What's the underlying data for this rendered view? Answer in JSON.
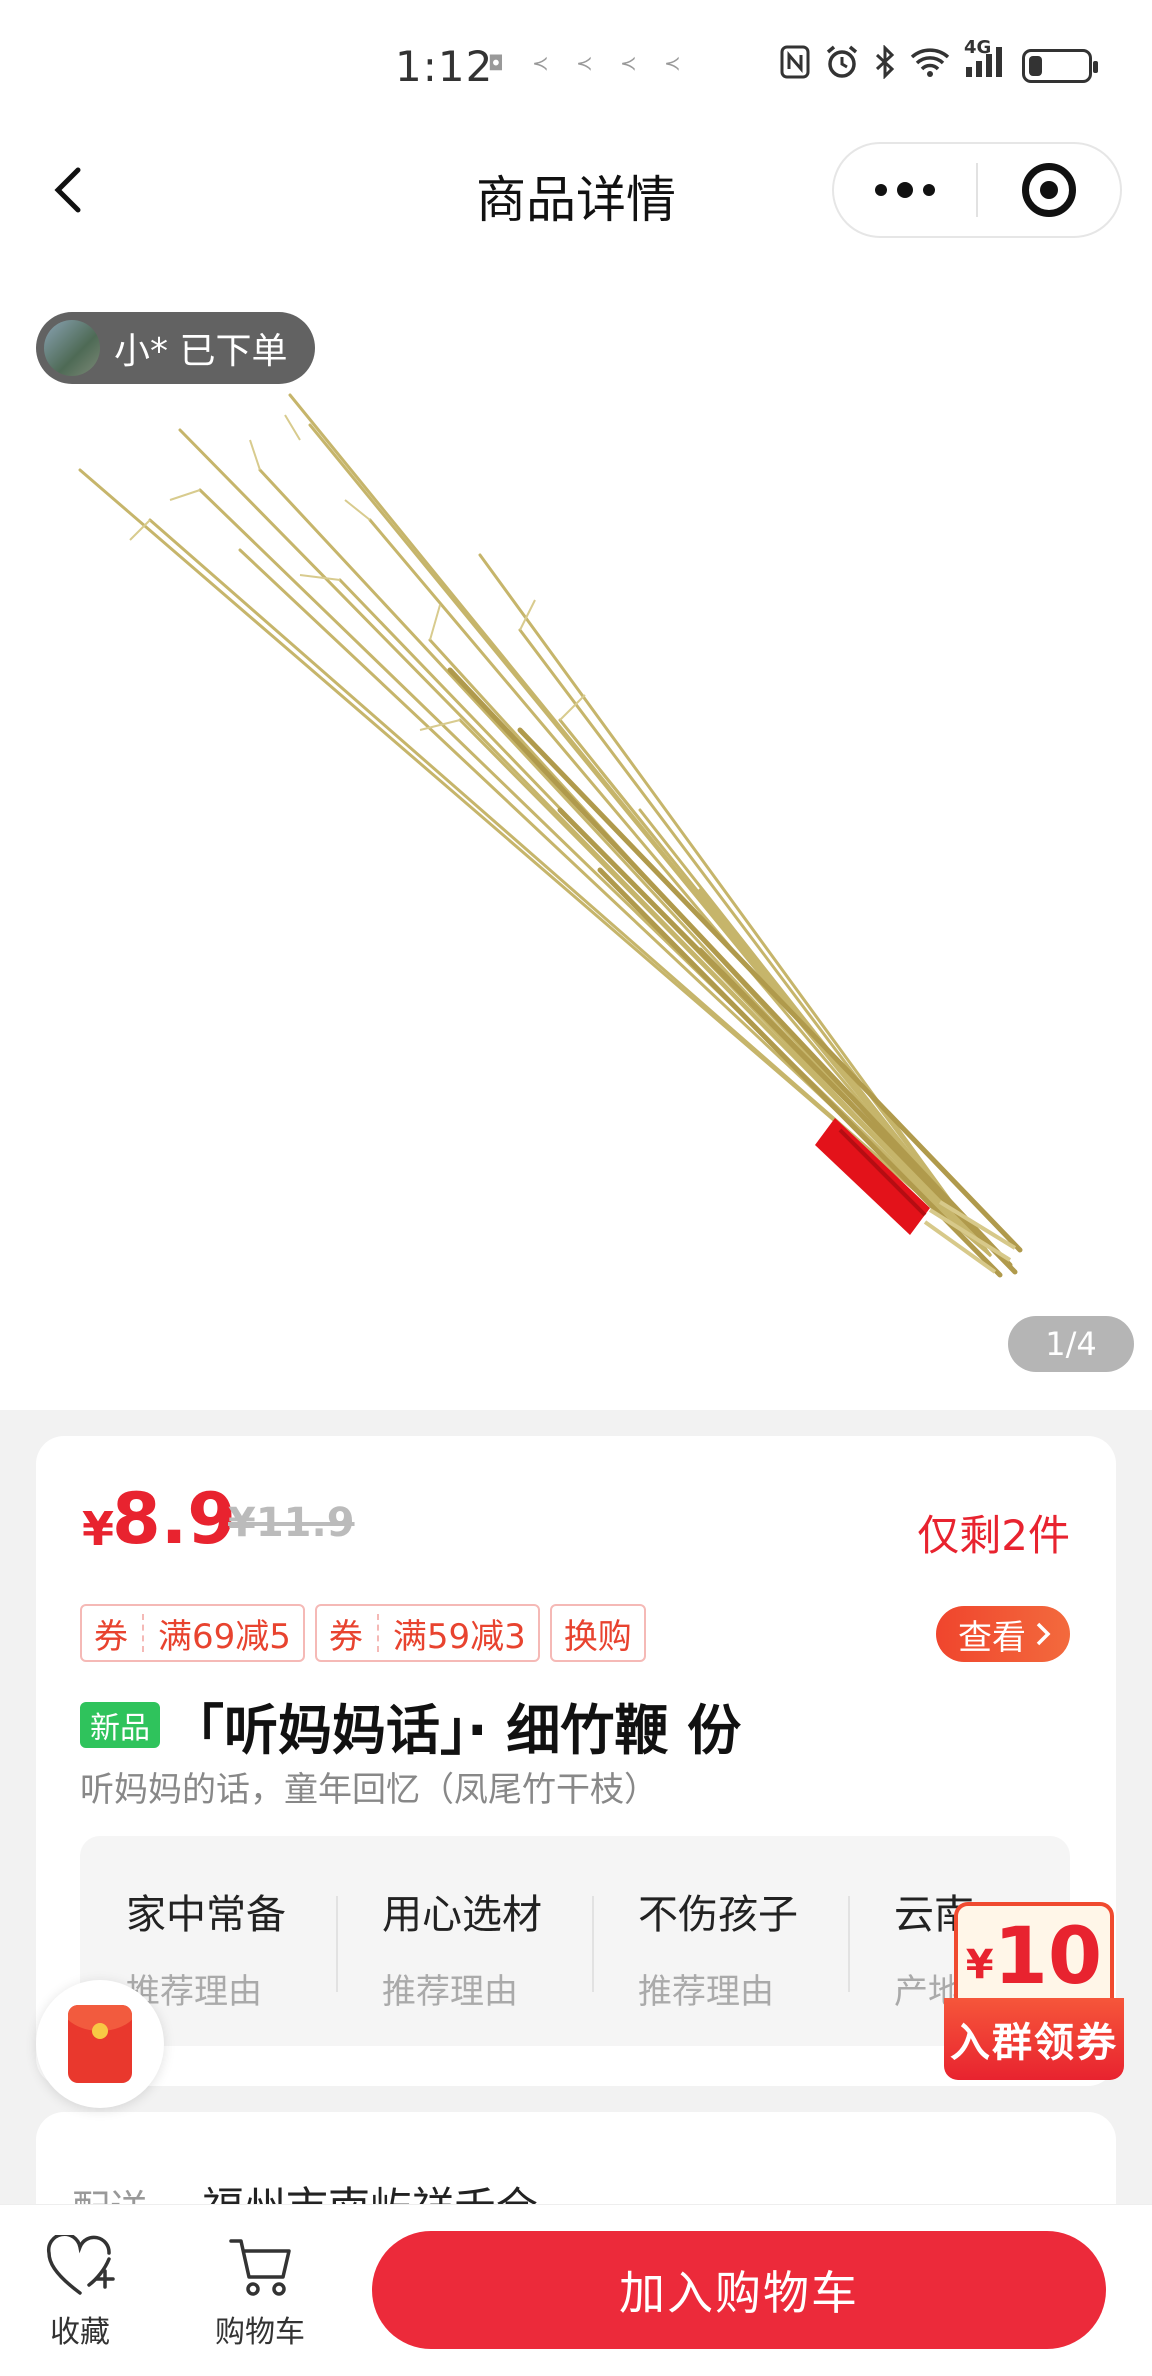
{
  "status_bar": {
    "time": "1:12",
    "network": "4G",
    "icons": [
      "nfc-icon",
      "alarm-icon",
      "bluetooth-icon",
      "wifi-icon",
      "signal-icon",
      "battery-icon"
    ],
    "battery_level": 0.2
  },
  "nav": {
    "title": "商品详情",
    "icons": [
      "back-icon",
      "more-icon",
      "target-icon"
    ]
  },
  "hero": {
    "order_notice": "小* 已下单",
    "image_counter": "1/4"
  },
  "product": {
    "price_currency": "¥",
    "price": "8.9",
    "original_price": "¥11.9",
    "stock_notice": "仅剩2件",
    "coupons": [
      {
        "type": "券",
        "text": "满69减5"
      },
      {
        "type": "券",
        "text": "满59减3"
      }
    ],
    "exchange_tag": "换购",
    "view_button": "查看",
    "new_badge": "新品",
    "title": "「听妈妈话」· 细竹鞭 份",
    "subtitle": "听妈妈的话，童年回忆（凤尾竹干枝）",
    "reasons": [
      {
        "title": "家中常备",
        "sub": "推荐理由"
      },
      {
        "title": "用心选材",
        "sub": "推荐理由"
      },
      {
        "title": "不伤孩子",
        "sub": "推荐理由"
      },
      {
        "title": "云南",
        "sub": "产地"
      }
    ]
  },
  "coupon_float": {
    "currency": "¥",
    "amount": "10",
    "label": "入群领券"
  },
  "delivery": {
    "label": "配送",
    "value": "福州市南屿祥禾仓"
  },
  "bottom_bar": {
    "favorite_label": "收藏",
    "cart_label": "购物车",
    "add_to_cart": "加入购物车"
  },
  "colors": {
    "accent_red": "#e8232f",
    "button_red": "#ec2a3a",
    "new_green": "#2fc35c"
  }
}
